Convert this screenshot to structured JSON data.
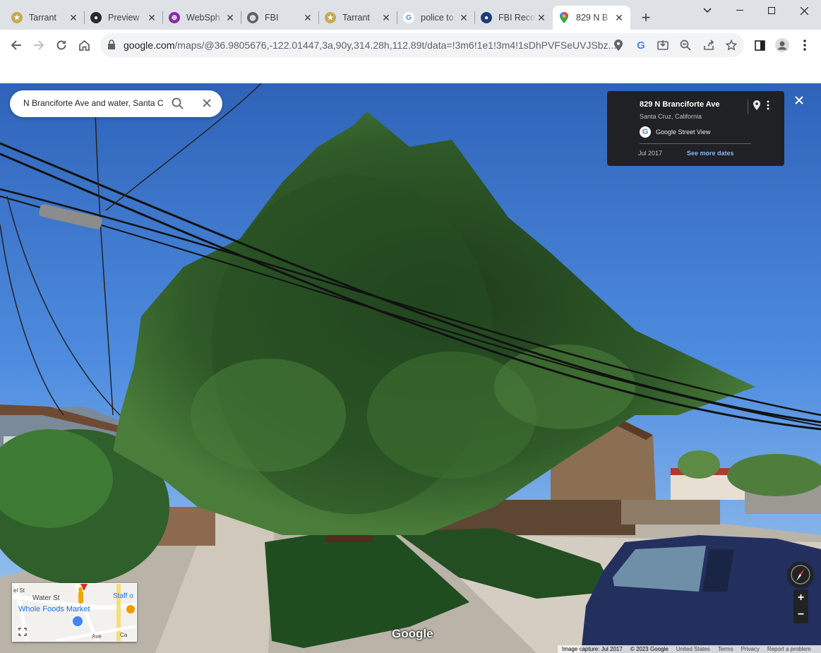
{
  "tabs": [
    {
      "title": "Tarrant",
      "icon": "seal-icon",
      "color": "#8d6e2f"
    },
    {
      "title": "Preview",
      "icon": "github-icon",
      "color": "#24292f"
    },
    {
      "title": "WebSph",
      "icon": "globe-grid-icon",
      "color": "#8e24aa"
    },
    {
      "title": "FBI",
      "icon": "globe-icon",
      "color": "#5f6368"
    },
    {
      "title": "Tarrant",
      "icon": "seal-icon",
      "color": "#8d6e2f"
    },
    {
      "title": "police to",
      "icon": "google-icon",
      "color": "#4285f4"
    },
    {
      "title": "FBI Reco",
      "icon": "fbi-seal-icon",
      "color": "#1a3d7c"
    },
    {
      "title": "829 N B",
      "icon": "maps-pin-icon",
      "color": "#34a853",
      "active": true
    }
  ],
  "toolbar": {
    "url_host": "google.com",
    "url_path": "/maps/@36.9805676,-122.01447,3a,90y,314.28h,112.89t/data=!3m6!1e1!3m4!1sDhPVFSeUVJSbz..."
  },
  "streetview": {
    "search_value": "N Branciforte Ave and water, Santa Cruz",
    "info": {
      "address": "829 N Branciforte Ave",
      "city": "Santa Cruz, California",
      "source": "Google Street View",
      "date": "Jul 2017",
      "more_dates": "See more dates"
    },
    "minimap": {
      "street_1": "Water St",
      "street_2": "Whole Foods Market",
      "street_3": "Staff o",
      "street_4": "Ave",
      "street_5": "Ca",
      "street_6": "el St"
    },
    "zoom_in": "+",
    "zoom_out": "−",
    "logo": "Google",
    "footer": {
      "capture": "Image capture: Jul 2017",
      "copyright": "© 2023 Google",
      "country": "United States",
      "terms": "Terms",
      "privacy": "Privacy",
      "report": "Report a problem"
    }
  }
}
